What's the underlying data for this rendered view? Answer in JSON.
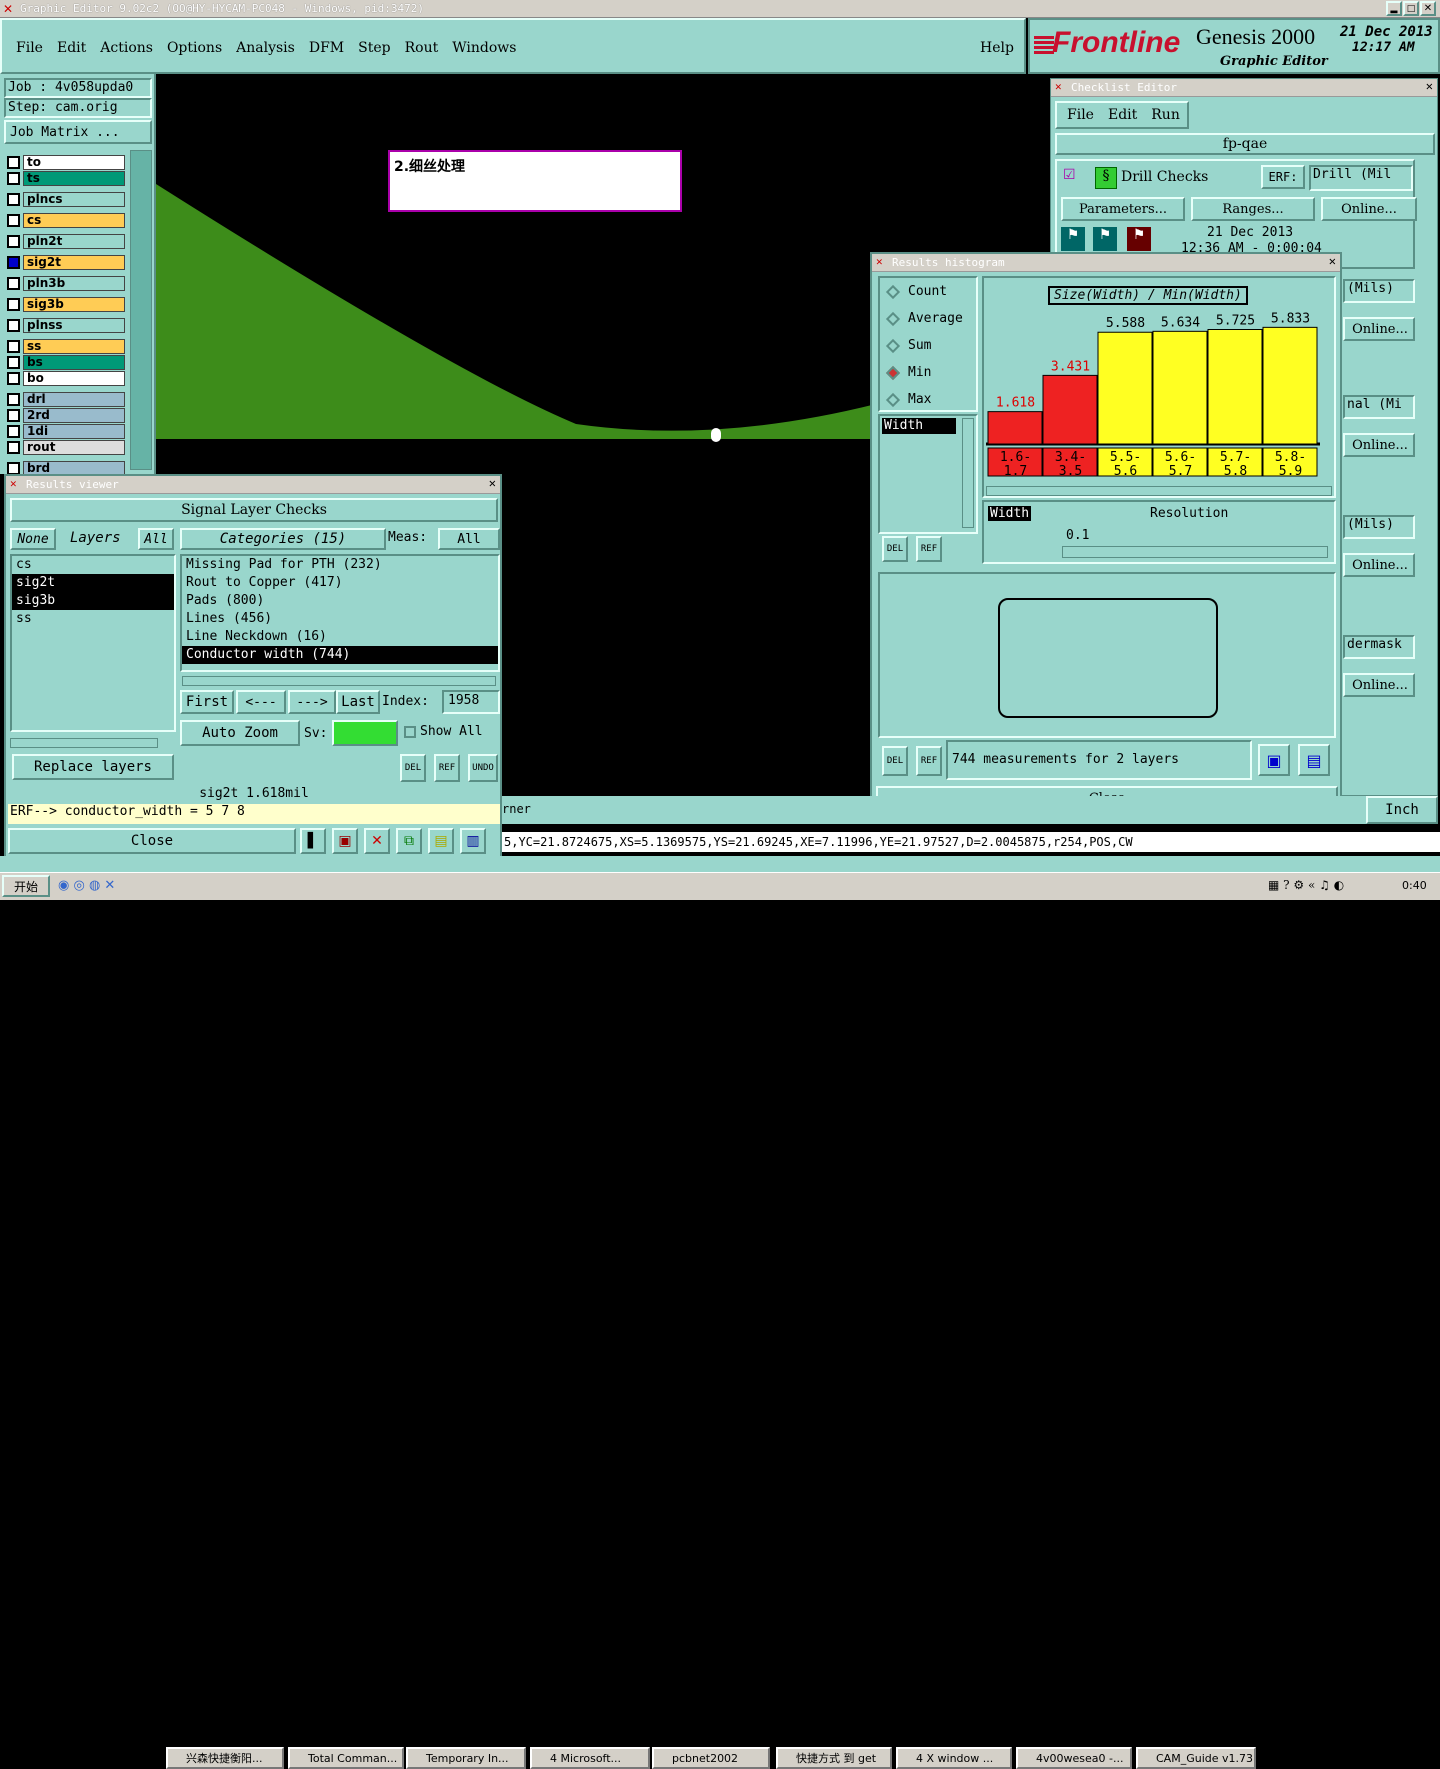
{
  "window_title": "Graphic Editor 9.02c2 (OO@HY-HYCAM-PC048 - Windows, pid:3472)",
  "menu": [
    "File",
    "Edit",
    "Actions",
    "Options",
    "Analysis",
    "DFM",
    "Step",
    "Rout",
    "Windows"
  ],
  "help": "Help",
  "brand": {
    "logo": "Frontline",
    "product": "Genesis 2000",
    "subtitle": "Graphic Editor",
    "date": "21 Dec 2013",
    "time": "12:17 AM"
  },
  "job": {
    "job": "Job : 4v058upda0",
    "step": "Step: cam.orig",
    "matrix": "Job Matrix ..."
  },
  "layers": [
    {
      "name": "to",
      "color": "#ffffff"
    },
    {
      "name": "ts",
      "color": "#009977"
    },
    {
      "name": "plncs",
      "color": "#99d6cc"
    },
    {
      "name": "cs",
      "color": "#ffcc55"
    },
    {
      "name": "pln2t",
      "color": "#99d6cc"
    },
    {
      "name": "sig2t",
      "color": "#ffcc55"
    },
    {
      "name": "pln3b",
      "color": "#99d6cc"
    },
    {
      "name": "sig3b",
      "color": "#ffcc55"
    },
    {
      "name": "plnss",
      "color": "#99d6cc"
    },
    {
      "name": "ss",
      "color": "#ffcc55"
    },
    {
      "name": "bs",
      "color": "#009977"
    },
    {
      "name": "bo",
      "color": "#ffffff"
    },
    {
      "name": "drl",
      "color": "#99bbcc"
    },
    {
      "name": "2rd",
      "color": "#99bbcc"
    },
    {
      "name": "1di",
      "color": "#99bbcc"
    },
    {
      "name": "rout",
      "color": "#dddddd"
    },
    {
      "name": "brd",
      "color": "#99bbcc"
    }
  ],
  "note": "2.细丝处理",
  "results_viewer": {
    "title": "Results viewer",
    "header": "Signal Layer Checks",
    "none": "None",
    "layers_label": "Layers",
    "all": "All",
    "layers": [
      "cs",
      "sig2t",
      "sig3b",
      "ss"
    ],
    "categories_label": "Categories (15)",
    "meas_label": "Meas:",
    "meas_value": "All",
    "categories": [
      "Missing Pad for PTH (232)",
      "Rout to Copper (417)",
      "Pads (800)",
      "Lines (456)",
      "Line Neckdown (16)",
      "Conductor width (744)"
    ],
    "first": "First",
    "prev": "<---",
    "next": "--->",
    "last": "Last",
    "index_label": "Index:",
    "index_value": "1958",
    "auto_zoom": "Auto Zoom",
    "sv_label": "Sv:",
    "show_all": "Show All",
    "replace_layers": "Replace layers",
    "del": "DEL",
    "ref": "REF",
    "undo": "UNDO",
    "status": "sig2t 1.618mil",
    "erf": "ERF--> conductor_width = 5 7 8",
    "close": "Close"
  },
  "checklist": {
    "title": "Checklist Editor",
    "menu": [
      "File",
      "Edit",
      "Run"
    ],
    "name": "fp-qae",
    "drill_checks": "Drill Checks",
    "erf": "ERF:",
    "erf_value": "Drill (Mil",
    "parameters": "Parameters...",
    "ranges": "Ranges...",
    "online": "Online...",
    "date": "21 Dec 2013",
    "time": "12:36 AM - 0:00:04",
    "side_texts": [
      "(Mils)",
      "nal (Mi",
      "(Mils)",
      "dermask"
    ]
  },
  "histogram": {
    "title": "Results histogram",
    "options": [
      "Count",
      "Average",
      "Sum",
      "Min",
      "Max"
    ],
    "selected": "Min",
    "attr": "Width",
    "chart_title": "Size(Width) / Min(Width)",
    "resolution_label": "Resolution",
    "resolution_value": "0.1",
    "width_label": "Width",
    "measurements": "744 measurements for 2 layers",
    "close": "Close",
    "del": "DEL",
    "ref": "REF"
  },
  "chart_data": {
    "type": "bar",
    "title": "Size(Width) / Min(Width)",
    "categories": [
      "1.6-1.7",
      "3.4-3.5",
      "5.5-5.6",
      "5.6-5.7",
      "5.7-5.8",
      "5.8-5.9"
    ],
    "values": [
      1.618,
      3.431,
      5.588,
      5.634,
      5.725,
      5.833
    ],
    "colors": [
      "#ee2222",
      "#ee2222",
      "#ffff22",
      "#ffff22",
      "#ffff22",
      "#ffff22"
    ],
    "label_colors": [
      "#dd0000",
      "#dd0000",
      "#000000",
      "#000000",
      "#000000",
      "#000000"
    ],
    "ylim": [
      0,
      6.4
    ]
  },
  "status_line": "5,YC=21.8724675,XS=5.1369575,YS=21.69245,XE=7.11996,YE=21.97527,D=2.0045875,r254,POS,CW",
  "corner_text": "rner",
  "units": "Inch",
  "taskbar": {
    "start": "开始",
    "items": [
      "兴森快捷衡阳...",
      "Total Comman...",
      "Temporary In...",
      "4 Microsoft...",
      "pcbnet2002",
      "快捷方式 到 get",
      "4 X window ...",
      "4v00wesea0 -...",
      "CAM_Guide v1.73"
    ],
    "clock": "0:40"
  }
}
